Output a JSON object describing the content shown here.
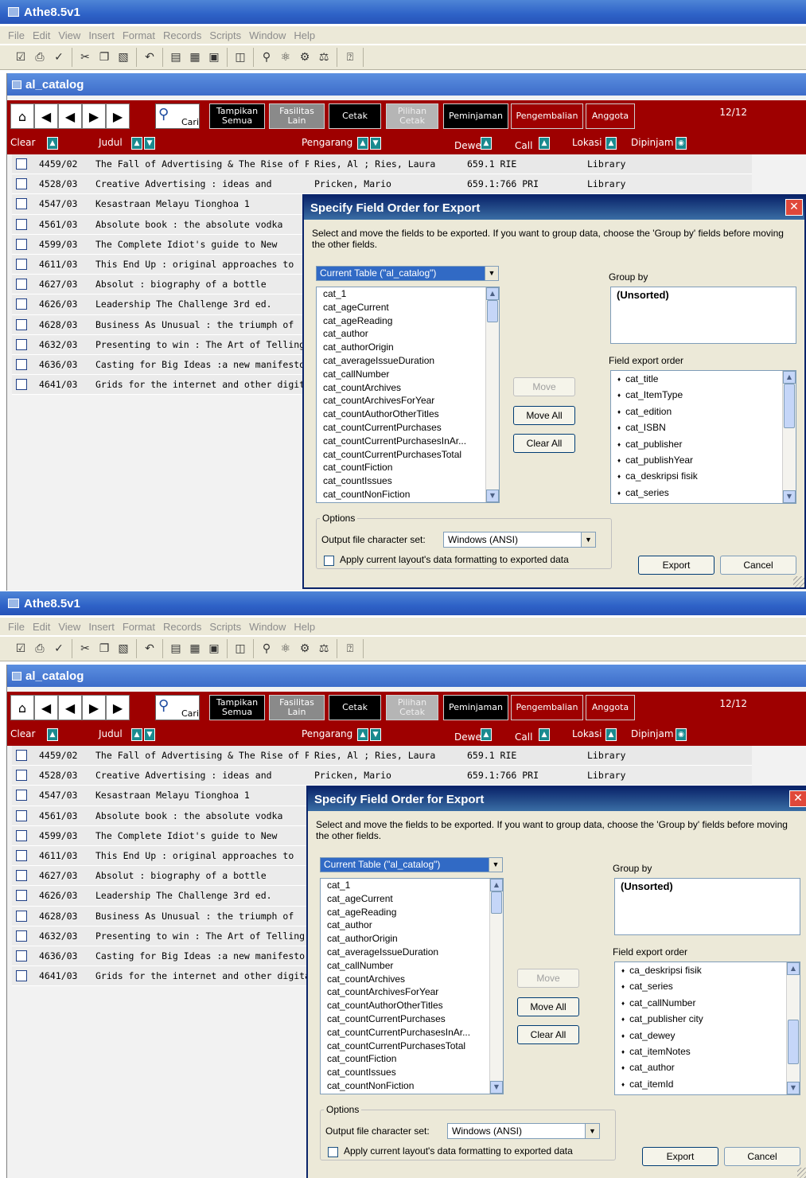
{
  "app": {
    "title": "Athe8.5v1"
  },
  "menu": [
    "File",
    "Edit",
    "View",
    "Insert",
    "Format",
    "Records",
    "Scripts",
    "Window",
    "Help"
  ],
  "document": {
    "title": "al_catalog"
  },
  "header": {
    "search_label": "Cari",
    "buttons": [
      {
        "label": "Tampikan Semua",
        "style": "black"
      },
      {
        "label": "Fasilitas Lain",
        "style": "gray"
      },
      {
        "label": "Cetak",
        "style": "black"
      },
      {
        "label": "Pilihan Cetak",
        "style": "gray-light"
      },
      {
        "label": "Peminjaman",
        "style": "black"
      },
      {
        "label": "Pengembalian",
        "style": "red"
      },
      {
        "label": "Anggota",
        "style": "red"
      }
    ],
    "record_count": "12/12"
  },
  "columns": {
    "clear": "Clear",
    "judul": "Judul",
    "pengarang": "Pengarang",
    "dewey": "Dewe",
    "call": "Call",
    "lokasi": "Lokasi",
    "dipinjam": "Dipinjam"
  },
  "records": [
    {
      "id": "4459/02",
      "title": "The Fall of Advertising & The Rise of PR",
      "author": "Ries, Al ; Ries, Laura",
      "call": "659.1 RIE",
      "location": "Library"
    },
    {
      "id": "4528/03",
      "title": "Creative Advertising : ideas and",
      "author": "Pricken, Mario",
      "call": "659.1:766 PRI",
      "location": "Library"
    },
    {
      "id": "4547/03",
      "title": "Kesastraan Melayu Tionghoa 1",
      "author": "",
      "call": "",
      "location": ""
    },
    {
      "id": "4561/03",
      "title": "Absolute book : the absolute vodka",
      "author": "",
      "call": "",
      "location": ""
    },
    {
      "id": "4599/03",
      "title": "The Complete Idiot's guide to New",
      "author": "",
      "call": "",
      "location": ""
    },
    {
      "id": "4611/03",
      "title": "This End Up : original approaches to",
      "author": "",
      "call": "",
      "location": ""
    },
    {
      "id": "4627/03",
      "title": "Absolut : biography of a bottle",
      "author": "",
      "call": "",
      "location": ""
    },
    {
      "id": "4626/03",
      "title": "Leadership The Challenge 3rd ed.",
      "author": "",
      "call": "",
      "location": ""
    },
    {
      "id": "4628/03",
      "title": "Business As Unusual : the triumph of",
      "author": "",
      "call": "",
      "location": ""
    },
    {
      "id": "4632/03",
      "title": "Presenting to win : The Art of Telling",
      "author": "",
      "call": "",
      "location": ""
    },
    {
      "id": "4636/03",
      "title": "Casting for Big Ideas :a new manifesto",
      "author": "",
      "call": "",
      "location": ""
    },
    {
      "id": "4641/03",
      "title": "Grids for the internet and other digital",
      "author": "",
      "call": "",
      "location": ""
    }
  ],
  "dialog": {
    "title": "Specify Field Order for Export",
    "instructions": "Select and move the fields to be exported.  If you want to group data, choose the 'Group by' fields before moving the other fields.",
    "table_select": "Current Table (\"al_catalog\")",
    "fields": [
      "cat_1",
      "cat_ageCurrent",
      "cat_ageReading",
      "cat_author",
      "cat_authorOrigin",
      "cat_averageIssueDuration",
      "cat_callNumber",
      "cat_countArchives",
      "cat_countArchivesForYear",
      "cat_countAuthorOtherTitles",
      "cat_countCurrentPurchases",
      "cat_countCurrentPurchasesInAr...",
      "cat_countCurrentPurchasesTotal",
      "cat_countFiction",
      "cat_countIssues",
      "cat_countNonFiction"
    ],
    "move": "Move",
    "move_all": "Move All",
    "clear_all": "Clear All",
    "group_by_label": "Group by",
    "group_by_value": "(Unsorted)",
    "export_order_label": "Field export order",
    "options_label": "Options",
    "charset_label": "Output file character set:",
    "charset_value": "Windows (ANSI)",
    "apply_label": "Apply current layout's data formatting to exported data",
    "export": "Export",
    "cancel": "Cancel"
  },
  "export_orders": [
    [
      "cat_title",
      "cat_ItemType",
      "cat_edition",
      "cat_ISBN",
      "cat_publisher",
      "cat_publishYear",
      "ca_deskripsi fisik",
      "cat_series"
    ],
    [
      "ca_deskripsi fisik",
      "cat_series",
      "cat_callNumber",
      "cat_publisher city",
      "cat_dewey",
      "cat_itemNotes",
      "cat_author",
      "cat_itemId"
    ]
  ],
  "scroll": {
    "field_list_position": 0.0,
    "export_order_position": [
      0.0,
      0.72
    ]
  }
}
